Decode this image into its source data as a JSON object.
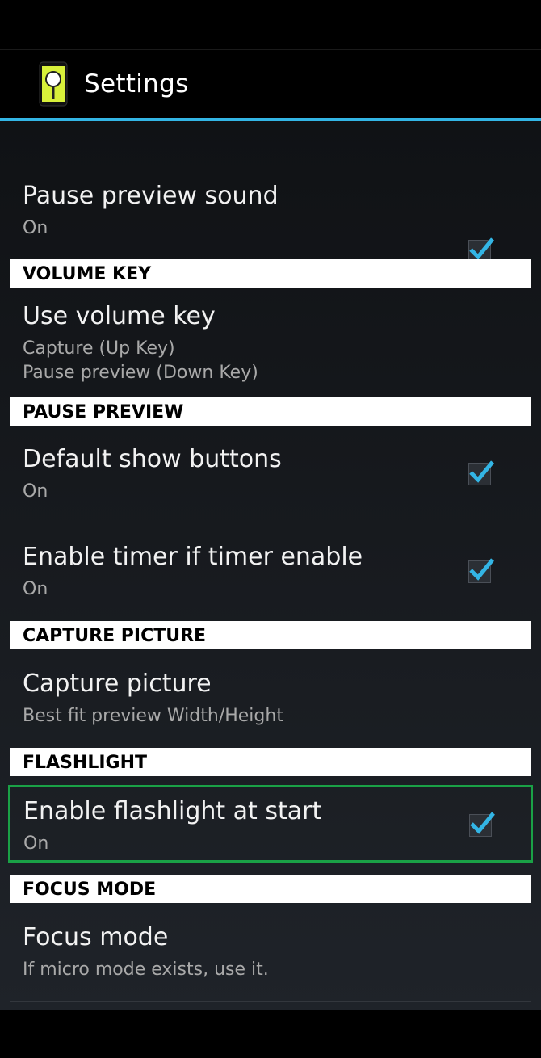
{
  "action_bar": {
    "title": "Settings",
    "app_icon": "magnifier-app-icon"
  },
  "prefs": {
    "partial": {
      "summary": "On",
      "checked": true
    },
    "pause_preview_sound": {
      "title": "Pause preview sound",
      "summary": "On",
      "checked": true
    },
    "volume_key_category": "VOLUME KEY",
    "use_volume_key": {
      "title": "Use volume key",
      "summary_line1": "Capture (Up Key)",
      "summary_line2": "Pause preview (Down Key)"
    },
    "pause_preview_category": "PAUSE PREVIEW",
    "default_show_buttons": {
      "title": "Default show buttons",
      "summary": "On",
      "checked": true
    },
    "enable_timer": {
      "title": "Enable timer if timer enable",
      "summary": "On",
      "checked": true
    },
    "capture_picture_category": "CAPTURE PICTURE",
    "capture_picture": {
      "title": "Capture picture",
      "summary": "Best fit preview Width/Height"
    },
    "flashlight_category": "FLASHLIGHT",
    "enable_flashlight": {
      "title": "Enable flashlight at start",
      "summary": "On",
      "checked": true,
      "highlighted": true
    },
    "focus_mode_category": "FOCUS MODE",
    "focus_mode": {
      "title": "Focus mode",
      "summary": "If micro mode exists, use it."
    }
  },
  "colors": {
    "accent": "#33b5e5",
    "highlight": "#1aa146",
    "category_bg": "#ffffff"
  }
}
